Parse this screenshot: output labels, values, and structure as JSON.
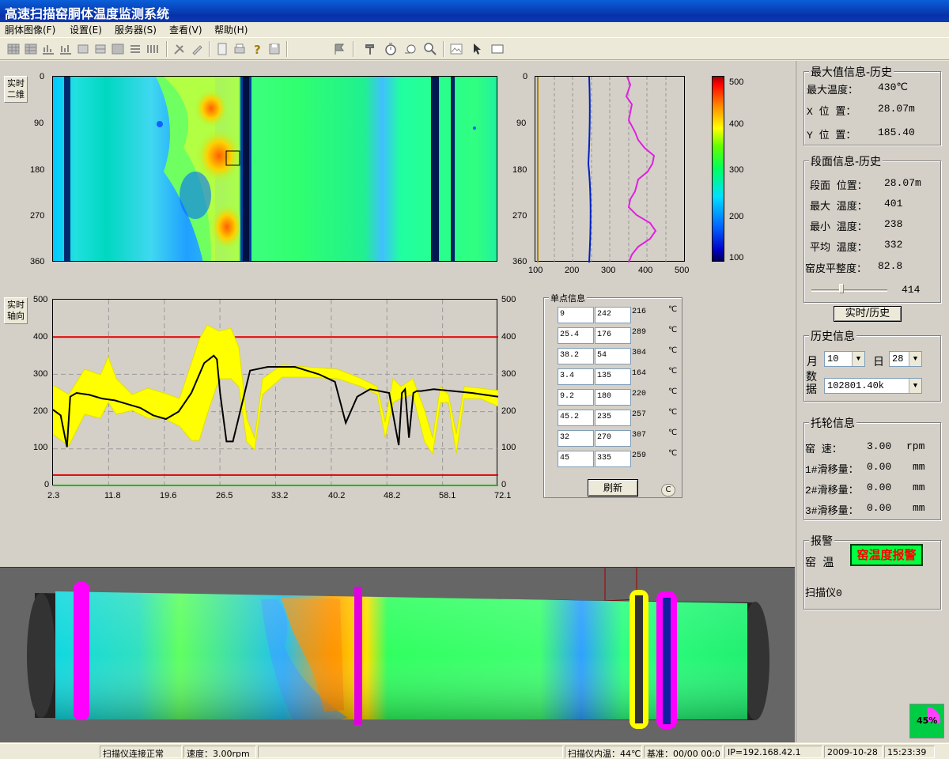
{
  "window": {
    "title": "高速扫描窑胴体温度监测系统"
  },
  "menu": [
    "胴体图像(F)",
    "设置(E)",
    "服务器(S)",
    "查看(V)",
    "帮助(H)"
  ],
  "side_buttons": {
    "realtime_2d": "实时二维",
    "realtime_axial": "实时轴向"
  },
  "heatmap": {
    "y_ticks": [
      "0",
      "90",
      "180",
      "270",
      "360"
    ]
  },
  "profile": {
    "x_ticks": [
      "100",
      "200",
      "300",
      "400",
      "500"
    ],
    "y_ticks": [
      "0",
      "90",
      "180",
      "270",
      "360"
    ]
  },
  "colorbar": {
    "ticks": [
      "500",
      "400",
      "300",
      "200",
      "100"
    ]
  },
  "linechart": {
    "y_ticks_left": [
      "500",
      "400",
      "300",
      "200",
      "100",
      "0"
    ],
    "y_ticks_right": [
      "500",
      "400",
      "300",
      "200",
      "100",
      "0"
    ],
    "x_ticks": [
      "2.3",
      "11.8",
      "19.6",
      "26.5",
      "33.2",
      "40.2",
      "48.2",
      "58.1",
      "72.1"
    ]
  },
  "chart_data": {
    "type": "line",
    "x": [
      2.3,
      3.5,
      4.5,
      5.0,
      6.0,
      8.0,
      10.0,
      12.0,
      14.0,
      16.0,
      18.0,
      20.0,
      22.0,
      24.0,
      26.0,
      27.5,
      28.0,
      28.5,
      29.5,
      30.5,
      33.2,
      36.0,
      40.2,
      44.0,
      46.5,
      48.2,
      50.0,
      52.0,
      55.0,
      56.5,
      57.0,
      57.5,
      58.1,
      58.8,
      59.3,
      60.0,
      62.0,
      65.0,
      68.0,
      70.0,
      72.1
    ],
    "series": [
      {
        "values": [
          205,
          190,
          105,
          240,
          250,
          245,
          235,
          230,
          220,
          210,
          190,
          180,
          200,
          250,
          330,
          350,
          340,
          250,
          120,
          120,
          310,
          320,
          320,
          300,
          280,
          170,
          240,
          260,
          250,
          110,
          250,
          260,
          130,
          250,
          255,
          255,
          260,
          255,
          250,
          245,
          240
        ]
      }
    ],
    "reference_lines": [
      400,
      30,
      0
    ],
    "xlim": [
      2.3,
      72.1
    ],
    "ylim": [
      0,
      500
    ]
  },
  "single_point": {
    "legend": "单点信息",
    "rows": [
      {
        "pos": "9",
        "angle": "242",
        "temp": "216"
      },
      {
        "pos": "25.4",
        "angle": "176",
        "temp": "289"
      },
      {
        "pos": "38.2",
        "angle": "54",
        "temp": "304"
      },
      {
        "pos": "3.4",
        "angle": "135",
        "temp": "164"
      },
      {
        "pos": "9.2",
        "angle": "180",
        "temp": "220"
      },
      {
        "pos": "45.2",
        "angle": "235",
        "temp": "257"
      },
      {
        "pos": "32",
        "angle": "270",
        "temp": "307"
      },
      {
        "pos": "45",
        "angle": "335",
        "temp": "259"
      }
    ],
    "unit": "℃",
    "refresh": "刷新",
    "c_btn": "C"
  },
  "max_info": {
    "title": "最大值信息-历史",
    "max_temp_label": "最大温度：",
    "max_temp": "430℃",
    "x_label": "X  位 置：",
    "x_val": "28.07m",
    "y_label": "Y  位 置：",
    "y_val": "185.40"
  },
  "section_info": {
    "title": "段面信息-历史",
    "pos_label": "段面 位置：",
    "pos_val": "28.07m",
    "max_label": "最大 温度：",
    "max_val": "401",
    "min_label": "最小 温度：",
    "min_val": "238",
    "avg_label": "平均 温度：",
    "avg_val": "332",
    "flat_label": "窑皮平整度：",
    "flat_val": "82.8",
    "slider_val": "414",
    "slider_level": 0.4
  },
  "toggle_button": "实时/历史",
  "history": {
    "title": "历史信息",
    "month_label": "月",
    "month_val": "10",
    "day_label": "日",
    "day_val": "28",
    "data_label": "数据",
    "data_val": "102801.40k"
  },
  "roller": {
    "title": "托轮信息",
    "speed_label": "窑    速：",
    "speed_val": "3.00",
    "speed_unit": "rpm",
    "s1_label": "1#滑移量：",
    "s1_val": "0.00",
    "s2_label": "2#滑移量：",
    "s2_val": "0.00",
    "s3_label": "3#滑移量：",
    "s3_val": "0.00",
    "mm": "mm"
  },
  "alarm": {
    "title": "报警",
    "kiln_label": "窑  温",
    "alarm_text": "窑温度报警",
    "scanner": "扫描仪0"
  },
  "cpu_gauge": "45%",
  "status": {
    "conn": "扫描仪连接正常",
    "speed": "速度：3.00rpm",
    "inner_temp": "扫描仪内温：44℃",
    "base": "基准：00/00 00:0",
    "ip": "IP=192.168.42.1",
    "date": "2009-10-28",
    "time": "15:23:39"
  },
  "colors": {
    "alarm_bg": "#00ff40",
    "alarm_text": "#ff0000",
    "ring_magenta": "#ff00ff",
    "ring_yellow": "#ffff00"
  }
}
